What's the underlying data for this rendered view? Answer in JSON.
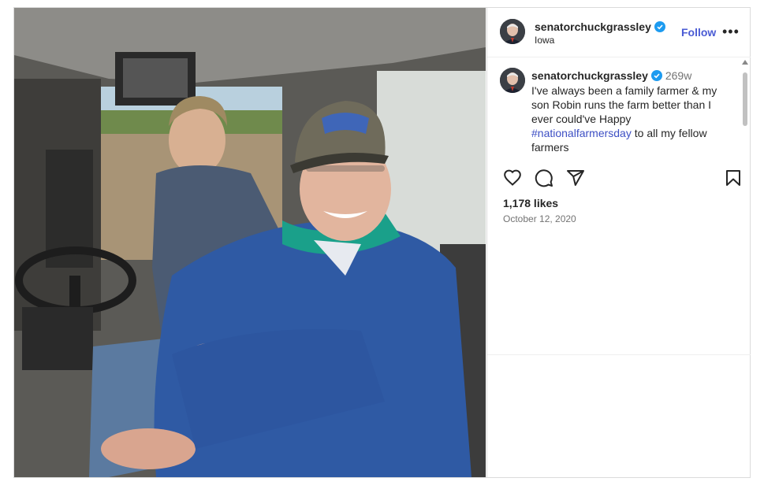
{
  "post": {
    "username": "senatorchuckgrassley",
    "location": "Iowa",
    "follow_label": "Follow",
    "more_label": "•••",
    "caption_time": "269w",
    "caption_text_1": "I've always been a family farmer & my son Robin runs the farm better than I ever could've Happy ",
    "hashtag": "#nationalfarmersday",
    "caption_text_2": " to all my fellow farmers",
    "likes": "1,178 likes",
    "date": "October 12, 2020"
  },
  "icons": {
    "verified": "verified-badge-icon",
    "like": "heart-icon",
    "comment": "comment-icon",
    "share": "share-icon",
    "save": "bookmark-icon"
  },
  "colors": {
    "accent": "#4a5bd4",
    "verified": "#1d9bf0",
    "text": "#262626",
    "muted": "#737373"
  }
}
